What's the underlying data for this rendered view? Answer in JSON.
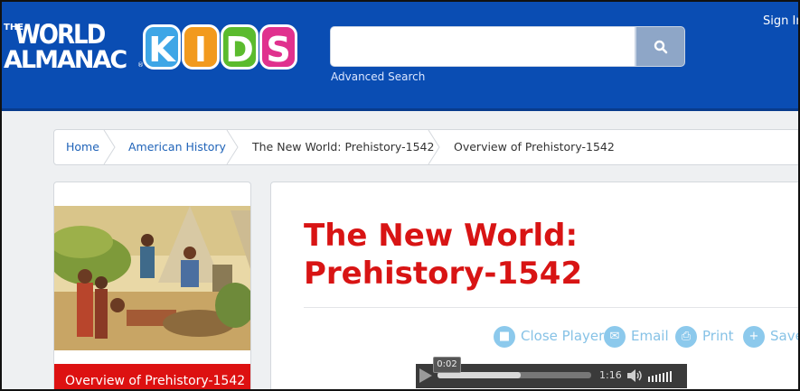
{
  "header": {
    "logo_the": "THE",
    "logo_world": "WORLD",
    "logo_almanac": "ALMANAC",
    "logo_tm": "®",
    "logo_kids": [
      "K",
      "I",
      "D",
      "S"
    ],
    "kids_colors": [
      "#3ea6e6",
      "#f29a1e",
      "#5bbb2e",
      "#e0318e"
    ],
    "search_placeholder": "",
    "search_icon": "search-icon",
    "advanced_search": "Advanced Search",
    "sign_in": "Sign In"
  },
  "breadcrumb": {
    "items": [
      "Home",
      "American History",
      "The New World: Prehistory-1542",
      "Overview of Prehistory-1542"
    ]
  },
  "sidebar": {
    "current_item": "Overview of Prehistory-1542"
  },
  "article": {
    "title": "The New World: Prehistory-1542",
    "tools": [
      {
        "label": "Close Player",
        "icon": "stop-icon"
      },
      {
        "label": "Email",
        "icon": "email-icon"
      },
      {
        "label": "Print",
        "icon": "print-icon"
      },
      {
        "label": "Save",
        "icon": "plus-icon"
      }
    ]
  },
  "player": {
    "current_time": "0:02",
    "duration": "1:16",
    "progress": 0.54,
    "volume_bars": 7
  },
  "colors": {
    "header": "#0a4db3",
    "title": "#d81414",
    "sidebar_bar": "#dd1111",
    "tool": "#86c2e6"
  }
}
